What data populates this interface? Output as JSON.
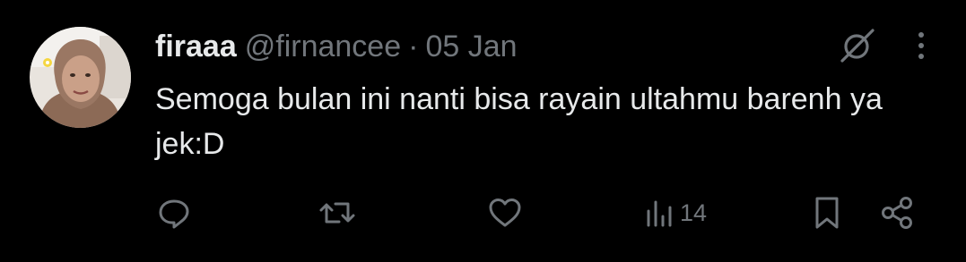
{
  "tweet": {
    "name": "firaaa",
    "handle": "@firnancee",
    "separator": "·",
    "date": "05 Jan",
    "text": "Semoga bulan ini nanti bisa rayain ultahmu barenh ya jek:D"
  },
  "icons": {
    "grok": "grok-icon",
    "more": "more-icon",
    "reply": "reply-icon",
    "repost": "repost-icon",
    "like": "like-icon",
    "views": "views-icon",
    "bookmark": "bookmark-icon",
    "share": "share-icon"
  },
  "actions": {
    "views_count": "14"
  },
  "colors": {
    "background": "#000000",
    "text": "#e7e9ea",
    "secondary": "#71767b"
  }
}
